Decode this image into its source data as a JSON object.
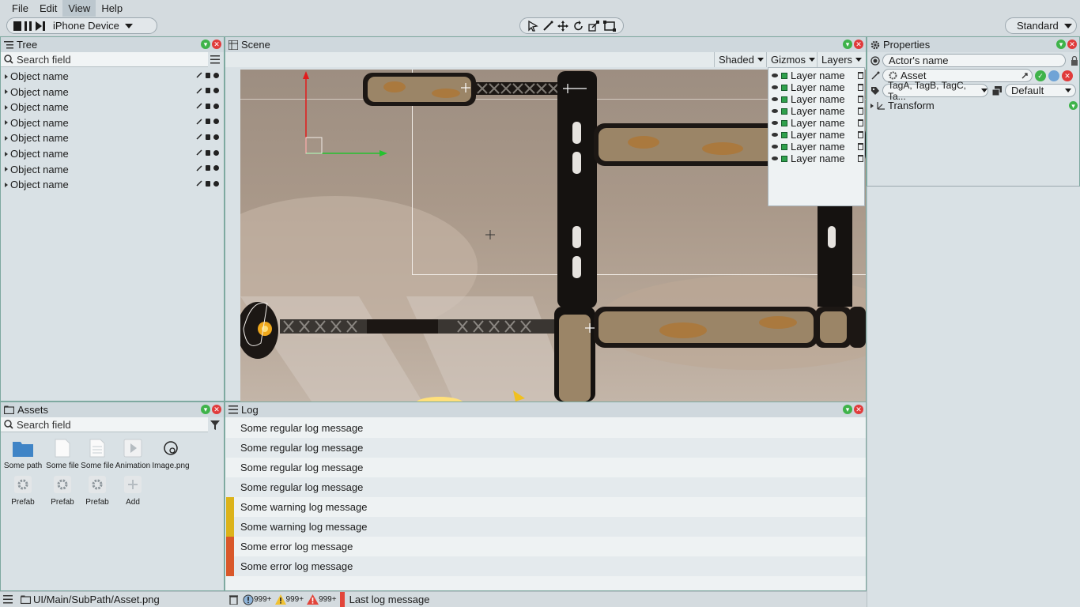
{
  "menu": {
    "items": [
      "File",
      "Edit",
      "View",
      "Help"
    ],
    "active": "View"
  },
  "toolbar": {
    "device": "iPhone Device",
    "layout": "Standard"
  },
  "tree": {
    "title": "Tree",
    "search_placeholder": "Search field",
    "items": [
      "Object name",
      "Object name",
      "Object name",
      "Object name",
      "Object name",
      "Object name",
      "Object name",
      "Object name"
    ]
  },
  "scene": {
    "title": "Scene",
    "shading": "Shaded",
    "gizmos": "Gizmos",
    "layers_label": "Layers",
    "layers": [
      "Layer name",
      "Layer name",
      "Layer name",
      "Layer name",
      "Layer name",
      "Layer name",
      "Layer name",
      "Layer name"
    ]
  },
  "properties": {
    "title": "Properties",
    "actor_name": "Actor's name",
    "asset": "Asset",
    "tags": "TagA, TagB, TagC, Ta...",
    "layer": "Default",
    "transform": "Transform"
  },
  "assets": {
    "title": "Assets",
    "search_placeholder": "Search field",
    "items": [
      {
        "label": "Some path",
        "icon": "folder-icon"
      },
      {
        "label": "Some file",
        "icon": "file-icon"
      },
      {
        "label": "Some file",
        "icon": "text-file-icon"
      },
      {
        "label": "Animation",
        "icon": "animation-icon"
      },
      {
        "label": "Image.png",
        "icon": "image-icon"
      },
      {
        "label": "Prefab",
        "icon": "prefab-icon"
      },
      {
        "label": "Prefab",
        "icon": "prefab-icon"
      },
      {
        "label": "Prefab",
        "icon": "prefab-icon"
      },
      {
        "label": "Add",
        "icon": "add-icon"
      }
    ],
    "path": "UI/Main/SubPath/Asset.png"
  },
  "log": {
    "title": "Log",
    "messages": [
      {
        "text": "Some regular log message",
        "level": "regular"
      },
      {
        "text": "Some regular log message",
        "level": "regular"
      },
      {
        "text": "Some regular log message",
        "level": "regular"
      },
      {
        "text": "Some regular log message",
        "level": "regular"
      },
      {
        "text": "Some warning log message",
        "level": "warning"
      },
      {
        "text": "Some warning log message",
        "level": "warning"
      },
      {
        "text": "Some error log message",
        "level": "error"
      },
      {
        "text": "Some error log message",
        "level": "error"
      }
    ],
    "info_count": "999+",
    "warning_count": "999+",
    "error_count": "999+",
    "last_message": "Last log message"
  },
  "colors": {
    "accent_green": "#3fb34a",
    "close_red": "#e03b3b",
    "warning": "#dcb31a",
    "error": "#d9582a"
  }
}
